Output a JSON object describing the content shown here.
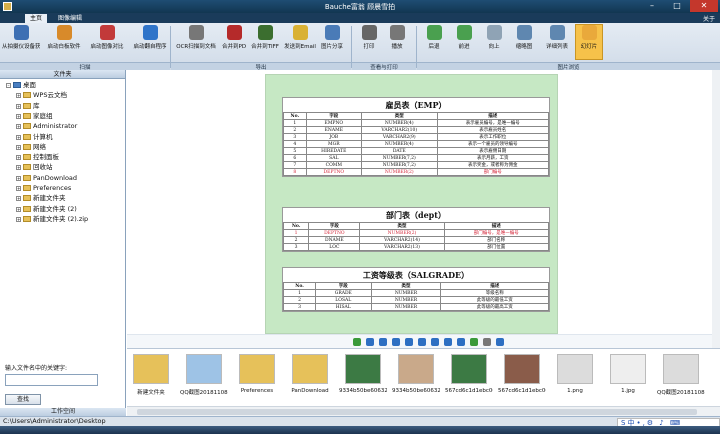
{
  "window": {
    "title": "Bauche富翁 顾晨雪拍"
  },
  "tabs": [
    "主页",
    "图像编辑"
  ],
  "about": "关于",
  "ribbon": {
    "buttons": [
      "从拍摄仪设备获取",
      "启动白板软件",
      "启动图像对比",
      "启动翻自程序",
      "OCR扫描到文档",
      "合并到PDF",
      "合并到TIFF",
      "发送到Email",
      "图片分享",
      "打印",
      "播放",
      "后退",
      "前进",
      "向上",
      "缩略图",
      "详细列表",
      "幻灯片"
    ],
    "groups": [
      "扫描",
      "导出",
      "查看与打印",
      "图片浏览"
    ]
  },
  "left": {
    "header": "文件夹",
    "tree": [
      "桌面",
      "WPS云文档",
      "库",
      "家庭组",
      "Administrator",
      "计算机",
      "网络",
      "控制面板",
      "回收站",
      "PanDownload",
      "Preferences",
      "新建文件夹",
      "新建文件夹 (2)",
      "新建文件夹 (2).zip"
    ],
    "search_label": "输入文件名中的关键字:",
    "search_value": "",
    "find_button": "查找",
    "workspace": "工作空间"
  },
  "document": {
    "emp": {
      "title": "雇员表（EMP）",
      "headers": [
        "No.",
        "字段",
        "类型",
        "描述"
      ],
      "rows": [
        [
          "1",
          "EMPNO",
          "NUMBER(4)",
          "表示雇员编号，是唯一编号"
        ],
        [
          "2",
          "ENAME",
          "VARCHAR2(10)",
          "表示雇员姓名"
        ],
        [
          "3",
          "JOB",
          "VARCHAR2(9)",
          "表示工作职位"
        ],
        [
          "4",
          "MGR",
          "NUMBER(4)",
          "表示一个雇员的领导编号"
        ],
        [
          "5",
          "HIREDATE",
          "DATE",
          "表示雇佣日期"
        ],
        [
          "6",
          "SAL",
          "NUMBER(7,2)",
          "表示月薪，工资"
        ],
        [
          "7",
          "COMM",
          "NUMBER(7,2)",
          "表示奖金，或者称为佣金"
        ],
        [
          "8",
          "DEPTNO",
          "NUMBER(2)",
          "部门编号"
        ]
      ]
    },
    "dept": {
      "title": "部门表（dept）",
      "headers": [
        "No.",
        "字段",
        "类型",
        "描述"
      ],
      "rows": [
        [
          "1",
          "DEPTNO",
          "NUMBER(2)",
          "部门编号，是唯一编号"
        ],
        [
          "2",
          "DNAME",
          "VARCHAR2(14)",
          "部门名称"
        ],
        [
          "3",
          "LOC",
          "VARCHAR2(13)",
          "部门位置"
        ]
      ]
    },
    "salgrade": {
      "title": "工资等级表（SALGRADE）",
      "headers": [
        "No.",
        "字段",
        "类型",
        "描述"
      ],
      "rows": [
        [
          "1",
          "GRADE",
          "NUMBER",
          "等级名称"
        ],
        [
          "2",
          "LOSAL",
          "NUMBER",
          "此等级的最低工资"
        ],
        [
          "3",
          "HISAL",
          "NUMBER",
          "此等级的最高工资"
        ]
      ]
    }
  },
  "thumbnails": [
    "新建文件夹",
    "QQ截图20181108183356.jpg",
    "Preferences",
    "PanDownload",
    "9334b50be606329...",
    "9334b50be606329...",
    "567cd6c1d1ebc06d...",
    "567cd6c1d1ebc06d...",
    "1.png",
    "1.jpg",
    "QQ截图20181108183358.jpg"
  ],
  "status": {
    "path": "C:\\Users\\Administrator\\Desktop"
  },
  "tray": {
    "text": "S中•,⚙ ♪ ⌨"
  },
  "colors": {
    "accent": "#1f4d73",
    "highlight": "#f6c24a",
    "red": "#d4283a",
    "page_bg": "#c6e8c4"
  }
}
